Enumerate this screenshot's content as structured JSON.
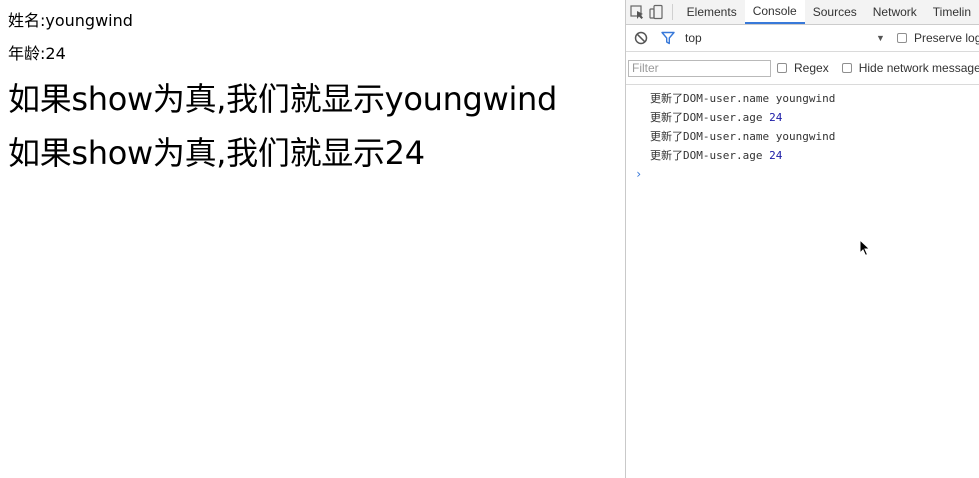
{
  "page": {
    "name_line": "姓名:youngwind",
    "age_line": "年龄:24",
    "show_name_line": "如果show为真,我们就显示youngwind",
    "show_age_line": "如果show为真,我们就显示24"
  },
  "devtools": {
    "tabs": [
      "Elements",
      "Console",
      "Sources",
      "Network",
      "Timelin"
    ],
    "active_tab": "Console",
    "context": "top",
    "preserve_log_label": "Preserve log",
    "filter_placeholder": "Filter",
    "regex_label": "Regex",
    "hide_network_label": "Hide network messages",
    "logs": [
      {
        "text": "更新了DOM-user.name youngwind",
        "num": ""
      },
      {
        "text": "更新了DOM-user.age ",
        "num": "24"
      },
      {
        "text": "更新了DOM-user.name youngwind",
        "num": ""
      },
      {
        "text": "更新了DOM-user.age ",
        "num": "24"
      }
    ],
    "prompt": "›"
  },
  "colors": {
    "accent": "#3879d9",
    "number": "#1a1aa6"
  }
}
